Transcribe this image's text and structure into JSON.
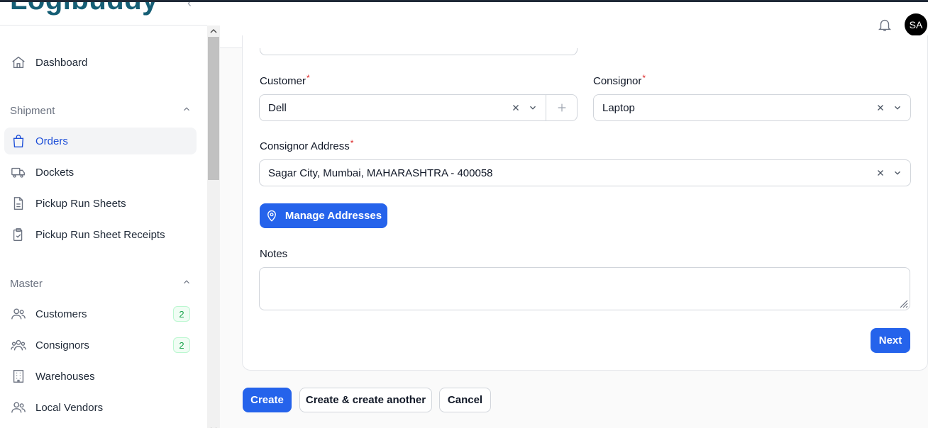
{
  "brand": {
    "logo_text": "Logibuddy"
  },
  "sidebar": {
    "dashboard": {
      "label": "Dashboard",
      "icon": "home-icon"
    },
    "groups": [
      {
        "label": "Shipment",
        "items": [
          {
            "label": "Orders",
            "icon": "shopping-bag-icon",
            "active": true
          },
          {
            "label": "Dockets",
            "icon": "truck-icon"
          },
          {
            "label": "Pickup Run Sheets",
            "icon": "document-icon"
          },
          {
            "label": "Pickup Run Sheet Receipts",
            "icon": "clipboard-check-icon"
          }
        ]
      },
      {
        "label": "Master",
        "items": [
          {
            "label": "Customers",
            "icon": "users-icon",
            "badge": "2"
          },
          {
            "label": "Consignors",
            "icon": "user-group-icon",
            "badge": "2"
          },
          {
            "label": "Warehouses",
            "icon": "building-icon"
          },
          {
            "label": "Local Vendors",
            "icon": "users-icon"
          }
        ]
      }
    ]
  },
  "header": {
    "avatar_initials": "SA"
  },
  "form": {
    "customer": {
      "label": "Customer",
      "required_mark": "*",
      "value": "Dell"
    },
    "consignor": {
      "label": "Consignor",
      "required_mark": "*",
      "value": "Laptop"
    },
    "consignor_address": {
      "label": "Consignor Address",
      "required_mark": "*",
      "value": "Sagar City, Mumbai, MAHARASHTRA - 400058"
    },
    "manage_addresses_label": "Manage Addresses",
    "notes": {
      "label": "Notes",
      "value": ""
    },
    "next_label": "Next"
  },
  "actions": {
    "create": "Create",
    "create_another": "Create & create another",
    "cancel": "Cancel"
  },
  "colors": {
    "primary": "#2563eb",
    "badge_green": "#16a34a",
    "required": "#dc2626"
  }
}
